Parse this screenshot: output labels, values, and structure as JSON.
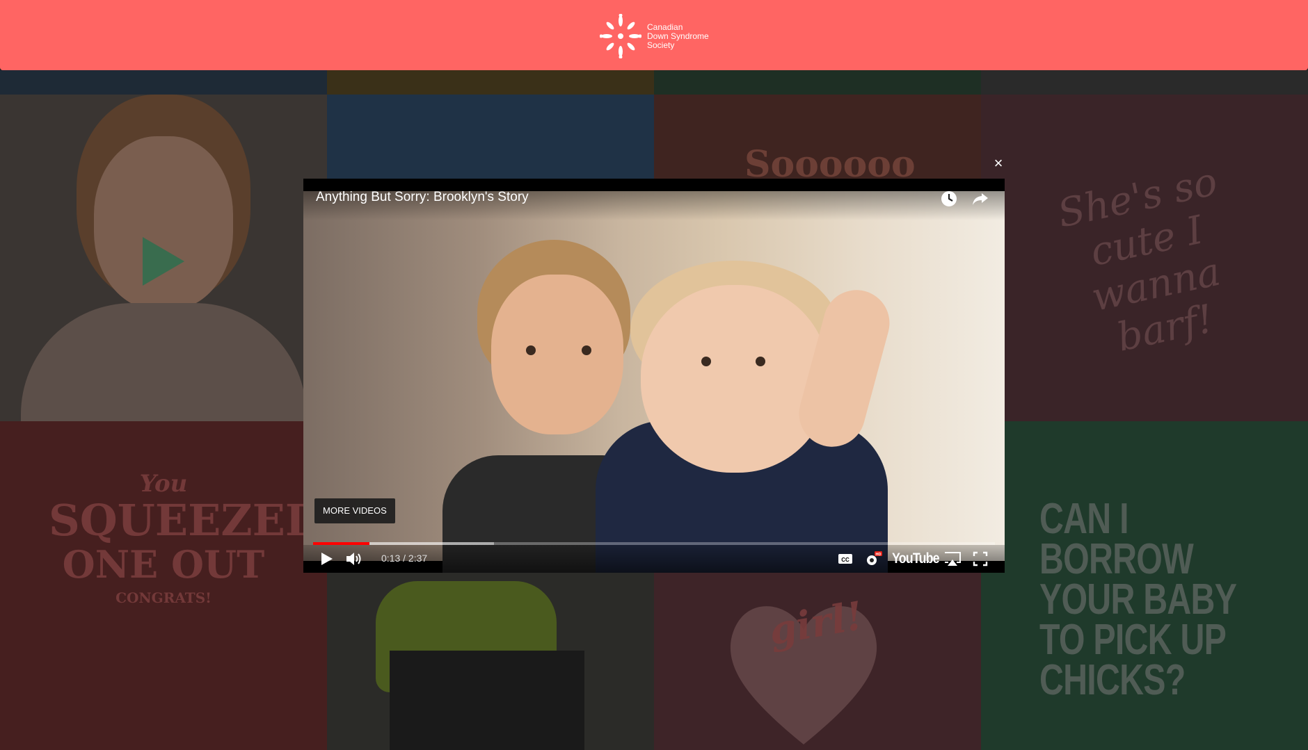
{
  "header": {
    "brand_line1": "Canadian",
    "brand_line2": "Down Syndrome",
    "brand_line3": "Society"
  },
  "tiles": {
    "cute_text": "She's so cute I wanna barf!",
    "borrow_text": "CAN I BORROW YOUR BABY TO PICK UP CHICKS?",
    "squeezed_top": "You",
    "squeezed_mid": "SQUEEZED",
    "squeezed_mid2": "ONE OUT",
    "squeezed_bottom": "CONGRATS!",
    "girl_text": "girl!"
  },
  "modal": {
    "close_label": "×"
  },
  "video": {
    "title": "Anything But Sorry: Brooklyn's Story",
    "more_videos": "MORE VIDEOS",
    "time": "0:13 / 2:37",
    "played_fraction": 0.0828,
    "loaded_fraction": 0.265,
    "youtube_label": "YouTube",
    "hd_badge": "HD"
  },
  "colors": {
    "header": "#ff6563",
    "progress": "#ff0000"
  },
  "icons": {
    "logo": "snowflake-icon",
    "watch_later": "clock-icon",
    "share": "share-icon",
    "play": "play-icon",
    "volume": "volume-icon",
    "captions": "cc-icon",
    "settings": "gear-icon",
    "airplay": "airplay-icon",
    "fullscreen": "fullscreen-icon"
  }
}
